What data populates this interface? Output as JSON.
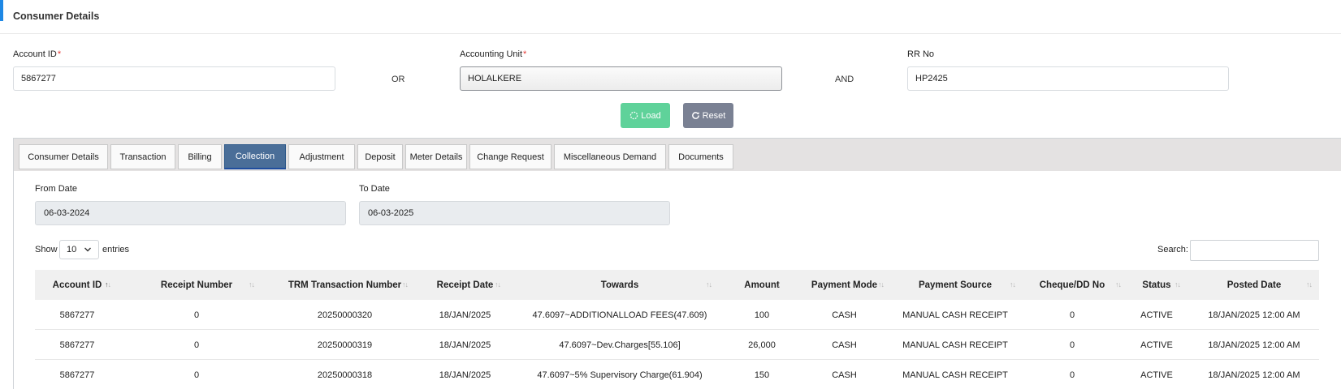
{
  "header": {
    "title": "Consumer Details"
  },
  "form": {
    "account_id": {
      "label": "Account ID",
      "required_mark": "*",
      "value": "5867277"
    },
    "or_text": "OR",
    "accounting_unit": {
      "label": "Accounting Unit",
      "required_mark": "*",
      "value": "HOLALKERE"
    },
    "and_text": "AND",
    "rr_no": {
      "label": "RR No",
      "value": "HP2425"
    }
  },
  "actions": {
    "load_label": "Load",
    "reset_label": "Reset"
  },
  "tabs": [
    {
      "label": "Consumer Details"
    },
    {
      "label": "Transaction"
    },
    {
      "label": "Billing"
    },
    {
      "label": "Collection"
    },
    {
      "label": "Adjustment"
    },
    {
      "label": "Deposit"
    },
    {
      "label": "Meter Details"
    },
    {
      "label": "Change Request"
    },
    {
      "label": "Miscellaneous Demand"
    },
    {
      "label": "Documents"
    }
  ],
  "active_tab": "Collection",
  "filters": {
    "from_date": {
      "label": "From Date",
      "value": "06-03-2024"
    },
    "to_date": {
      "label": "To Date",
      "value": "06-03-2025"
    }
  },
  "table_controls": {
    "show_label": "Show",
    "page_length": "10",
    "entries_label": "entries",
    "search_label": "Search:",
    "search_value": ""
  },
  "table": {
    "columns": [
      "Account ID",
      "Receipt Number",
      "TRM Transaction Number",
      "Receipt Date",
      "Towards",
      "Amount",
      "Payment Mode",
      "Payment Source",
      "Cheque/DD No",
      "Status",
      "Posted Date"
    ],
    "rows": [
      [
        "5867277",
        "0",
        "20250000320",
        "18/JAN/2025",
        "47.6097~ADDITIONALLOAD FEES(47.609)",
        "100",
        "CASH",
        "MANUAL CASH RECEIPT",
        "0",
        "ACTIVE",
        "18/JAN/2025 12:00 AM"
      ],
      [
        "5867277",
        "0",
        "20250000319",
        "18/JAN/2025",
        "47.6097~Dev.Charges[55.106]",
        "26,000",
        "CASH",
        "MANUAL CASH RECEIPT",
        "0",
        "ACTIVE",
        "18/JAN/2025 12:00 AM"
      ],
      [
        "5867277",
        "0",
        "20250000318",
        "18/JAN/2025",
        "47.6097~5% Supervisory Charge(61.904)",
        "150",
        "CASH",
        "MANUAL CASH RECEIPT",
        "0",
        "ACTIVE",
        "18/JAN/2025 12:00 AM"
      ]
    ]
  },
  "colors": {
    "accent": "#1e88e5",
    "load_button": "#5fd29a",
    "reset_button": "#7a8193",
    "active_tab": "#4a6e98",
    "required": "#e53935"
  },
  "icons": {
    "load": "spinner-icon",
    "reset": "refresh-icon",
    "sort": "sort-arrows-icon",
    "dropdown": "chevron-down-icon"
  }
}
